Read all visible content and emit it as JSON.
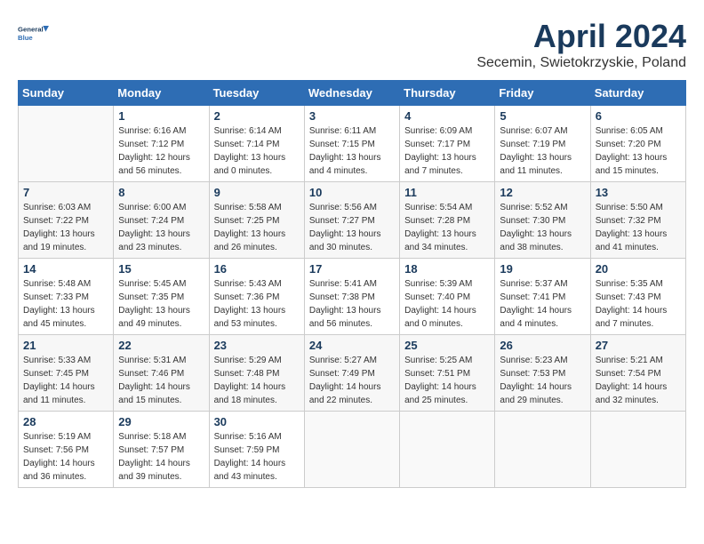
{
  "header": {
    "logo_line1": "General",
    "logo_line2": "Blue",
    "month": "April 2024",
    "location": "Secemin, Swietokrzyskie, Poland"
  },
  "days_of_week": [
    "Sunday",
    "Monday",
    "Tuesday",
    "Wednesday",
    "Thursday",
    "Friday",
    "Saturday"
  ],
  "weeks": [
    [
      {
        "day": "",
        "info": ""
      },
      {
        "day": "1",
        "info": "Sunrise: 6:16 AM\nSunset: 7:12 PM\nDaylight: 12 hours\nand 56 minutes."
      },
      {
        "day": "2",
        "info": "Sunrise: 6:14 AM\nSunset: 7:14 PM\nDaylight: 13 hours\nand 0 minutes."
      },
      {
        "day": "3",
        "info": "Sunrise: 6:11 AM\nSunset: 7:15 PM\nDaylight: 13 hours\nand 4 minutes."
      },
      {
        "day": "4",
        "info": "Sunrise: 6:09 AM\nSunset: 7:17 PM\nDaylight: 13 hours\nand 7 minutes."
      },
      {
        "day": "5",
        "info": "Sunrise: 6:07 AM\nSunset: 7:19 PM\nDaylight: 13 hours\nand 11 minutes."
      },
      {
        "day": "6",
        "info": "Sunrise: 6:05 AM\nSunset: 7:20 PM\nDaylight: 13 hours\nand 15 minutes."
      }
    ],
    [
      {
        "day": "7",
        "info": "Sunrise: 6:03 AM\nSunset: 7:22 PM\nDaylight: 13 hours\nand 19 minutes."
      },
      {
        "day": "8",
        "info": "Sunrise: 6:00 AM\nSunset: 7:24 PM\nDaylight: 13 hours\nand 23 minutes."
      },
      {
        "day": "9",
        "info": "Sunrise: 5:58 AM\nSunset: 7:25 PM\nDaylight: 13 hours\nand 26 minutes."
      },
      {
        "day": "10",
        "info": "Sunrise: 5:56 AM\nSunset: 7:27 PM\nDaylight: 13 hours\nand 30 minutes."
      },
      {
        "day": "11",
        "info": "Sunrise: 5:54 AM\nSunset: 7:28 PM\nDaylight: 13 hours\nand 34 minutes."
      },
      {
        "day": "12",
        "info": "Sunrise: 5:52 AM\nSunset: 7:30 PM\nDaylight: 13 hours\nand 38 minutes."
      },
      {
        "day": "13",
        "info": "Sunrise: 5:50 AM\nSunset: 7:32 PM\nDaylight: 13 hours\nand 41 minutes."
      }
    ],
    [
      {
        "day": "14",
        "info": "Sunrise: 5:48 AM\nSunset: 7:33 PM\nDaylight: 13 hours\nand 45 minutes."
      },
      {
        "day": "15",
        "info": "Sunrise: 5:45 AM\nSunset: 7:35 PM\nDaylight: 13 hours\nand 49 minutes."
      },
      {
        "day": "16",
        "info": "Sunrise: 5:43 AM\nSunset: 7:36 PM\nDaylight: 13 hours\nand 53 minutes."
      },
      {
        "day": "17",
        "info": "Sunrise: 5:41 AM\nSunset: 7:38 PM\nDaylight: 13 hours\nand 56 minutes."
      },
      {
        "day": "18",
        "info": "Sunrise: 5:39 AM\nSunset: 7:40 PM\nDaylight: 14 hours\nand 0 minutes."
      },
      {
        "day": "19",
        "info": "Sunrise: 5:37 AM\nSunset: 7:41 PM\nDaylight: 14 hours\nand 4 minutes."
      },
      {
        "day": "20",
        "info": "Sunrise: 5:35 AM\nSunset: 7:43 PM\nDaylight: 14 hours\nand 7 minutes."
      }
    ],
    [
      {
        "day": "21",
        "info": "Sunrise: 5:33 AM\nSunset: 7:45 PM\nDaylight: 14 hours\nand 11 minutes."
      },
      {
        "day": "22",
        "info": "Sunrise: 5:31 AM\nSunset: 7:46 PM\nDaylight: 14 hours\nand 15 minutes."
      },
      {
        "day": "23",
        "info": "Sunrise: 5:29 AM\nSunset: 7:48 PM\nDaylight: 14 hours\nand 18 minutes."
      },
      {
        "day": "24",
        "info": "Sunrise: 5:27 AM\nSunset: 7:49 PM\nDaylight: 14 hours\nand 22 minutes."
      },
      {
        "day": "25",
        "info": "Sunrise: 5:25 AM\nSunset: 7:51 PM\nDaylight: 14 hours\nand 25 minutes."
      },
      {
        "day": "26",
        "info": "Sunrise: 5:23 AM\nSunset: 7:53 PM\nDaylight: 14 hours\nand 29 minutes."
      },
      {
        "day": "27",
        "info": "Sunrise: 5:21 AM\nSunset: 7:54 PM\nDaylight: 14 hours\nand 32 minutes."
      }
    ],
    [
      {
        "day": "28",
        "info": "Sunrise: 5:19 AM\nSunset: 7:56 PM\nDaylight: 14 hours\nand 36 minutes."
      },
      {
        "day": "29",
        "info": "Sunrise: 5:18 AM\nSunset: 7:57 PM\nDaylight: 14 hours\nand 39 minutes."
      },
      {
        "day": "30",
        "info": "Sunrise: 5:16 AM\nSunset: 7:59 PM\nDaylight: 14 hours\nand 43 minutes."
      },
      {
        "day": "",
        "info": ""
      },
      {
        "day": "",
        "info": ""
      },
      {
        "day": "",
        "info": ""
      },
      {
        "day": "",
        "info": ""
      }
    ]
  ]
}
